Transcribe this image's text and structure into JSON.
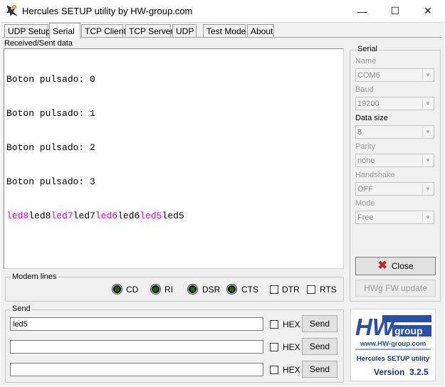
{
  "window": {
    "title": "Hercules SETUP utility by HW-group.com",
    "minimize_glyph": "—",
    "maximize_glyph": "☐",
    "close_glyph": "✕"
  },
  "tabs": [
    {
      "label": "UDP Setup",
      "active": false
    },
    {
      "label": "Serial",
      "active": true
    },
    {
      "label": "TCP Client",
      "active": false
    },
    {
      "label": "TCP Server",
      "active": false
    },
    {
      "label": "UDP",
      "active": false
    },
    {
      "label": "Test Mode",
      "active": false
    },
    {
      "label": "About",
      "active": false
    }
  ],
  "received": {
    "label": "Received/Sent data",
    "lines": [
      "Boton pulsado: 0",
      "Boton pulsado: 1",
      "Boton pulsado: 2",
      "Boton pulsado: 3"
    ],
    "sent_segments": [
      {
        "text": "led8",
        "sent": true
      },
      {
        "text": "led8",
        "sent": false
      },
      {
        "text": "led7",
        "sent": true
      },
      {
        "text": "led7",
        "sent": false
      },
      {
        "text": "led6",
        "sent": true
      },
      {
        "text": "led6",
        "sent": false
      },
      {
        "text": "led5",
        "sent": true
      },
      {
        "text": "led5",
        "sent": false
      }
    ],
    "sent_color": "#e000e0"
  },
  "serial": {
    "group_label": "Serial",
    "name_label": "Name",
    "name_value": "COM6",
    "baud_label": "Baud",
    "baud_value": "19200",
    "datasize_label": "Data size",
    "datasize_value": "8",
    "parity_label": "Parity",
    "parity_value": "none",
    "handshake_label": "Handshake",
    "handshake_value": "OFF",
    "mode_label": "Mode",
    "mode_value": "Free",
    "close_label": "Close",
    "close_icon": "red-x-icon",
    "fw_update_label": "HWg FW update"
  },
  "modem": {
    "group_label": "Modem lines",
    "cd": "CD",
    "ri": "RI",
    "dsr": "DSR",
    "cts": "CTS",
    "dtr": "DTR",
    "rts": "RTS"
  },
  "send": {
    "group_label": "Send",
    "rows": [
      {
        "value": "led5",
        "hex": "HEX",
        "button": "Send"
      },
      {
        "value": "",
        "hex": "HEX",
        "button": "Send"
      },
      {
        "value": "",
        "hex": "HEX",
        "button": "Send"
      }
    ]
  },
  "logo": {
    "hw": "HW",
    "group": "group",
    "url": "www.HW-group.com",
    "product": "Hercules SETUP utility",
    "version_label": "Version",
    "version": "3.2.5",
    "brand_color": "#2a4fa8"
  }
}
